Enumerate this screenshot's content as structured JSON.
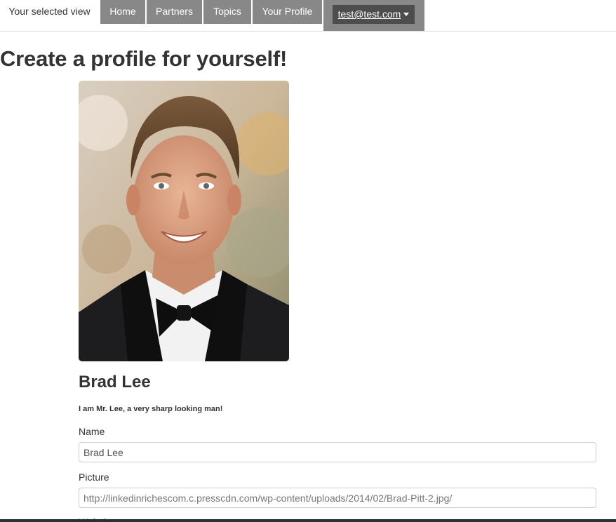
{
  "nav": {
    "current_view": "Your selected view",
    "tabs": [
      {
        "label": "Home"
      },
      {
        "label": "Partners"
      },
      {
        "label": "Topics"
      },
      {
        "label": "Your Profile"
      }
    ],
    "user_email": "test@test.com",
    "user_menu_icon": "caret-down-icon"
  },
  "page": {
    "title": "Create a profile for yourself!"
  },
  "profile": {
    "photo_icon": "profile-photo",
    "name": "Brad Lee",
    "bio": "I am Mr. Lee, a very sharp looking man!"
  },
  "form": {
    "name_label": "Name",
    "name_value": "Brad Lee",
    "picture_label": "Picture",
    "picture_value": "http://linkedinrichescom.c.presscdn.com/wp-content/uploads/2014/02/Brad-Pitt-2.jpg/",
    "website_label": "Website"
  },
  "colors": {
    "nav_tab_bg": "#888888",
    "user_button_bg": "#4d4d4d",
    "text": "#333333"
  }
}
